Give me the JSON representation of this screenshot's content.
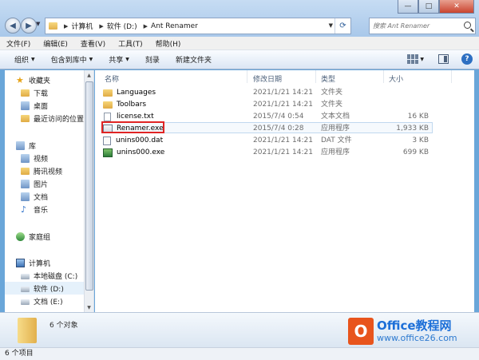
{
  "address": {
    "crumbs": [
      "计算机",
      "软件 (D:)",
      "Ant Renamer"
    ]
  },
  "search": {
    "placeholder": "搜索 Ant Renamer"
  },
  "window_controls": {
    "minimize": "—",
    "maximize": "□",
    "close": "✕"
  },
  "menu": [
    "文件(F)",
    "编辑(E)",
    "查看(V)",
    "工具(T)",
    "帮助(H)"
  ],
  "toolbar": {
    "organize": "组织",
    "include": "包含到库中",
    "share": "共享",
    "burn": "刻录",
    "new_folder": "新建文件夹",
    "help": "?"
  },
  "sidebar": {
    "favorites": "收藏夹",
    "downloads": "下载",
    "desktop": "桌面",
    "recent": "最近访问的位置",
    "libraries": "库",
    "videos": "视频",
    "tencent_video": "腾讯视频",
    "pictures": "图片",
    "documents": "文档",
    "music": "音乐",
    "homegroup": "家庭组",
    "computer": "计算机",
    "drive_c": "本地磁盘 (C:)",
    "drive_d": "软件 (D:)",
    "drive_e": "文档 (E:)"
  },
  "columns": {
    "name": "名称",
    "date": "修改日期",
    "type": "类型",
    "size": "大小"
  },
  "files": [
    {
      "name": "Languages",
      "date": "2021/1/21 14:21",
      "type": "文件夹",
      "size": "",
      "icon": "folder"
    },
    {
      "name": "Toolbars",
      "date": "2021/1/21 14:21",
      "type": "文件夹",
      "size": "",
      "icon": "folder"
    },
    {
      "name": "license.txt",
      "date": "2015/7/4 0:54",
      "type": "文本文档",
      "size": "16 KB",
      "icon": "text-file"
    },
    {
      "name": "Renamer.exe",
      "date": "2015/7/4 0:28",
      "type": "应用程序",
      "size": "1,933 KB",
      "icon": "application"
    },
    {
      "name": "unins000.dat",
      "date": "2021/1/21 14:21",
      "type": "DAT 文件",
      "size": "3 KB",
      "icon": "dat-file"
    },
    {
      "name": "unins000.exe",
      "date": "2021/1/21 14:21",
      "type": "应用程序",
      "size": "699 KB",
      "icon": "setup-app"
    }
  ],
  "details": {
    "count": "6 个对象"
  },
  "status": {
    "count": "6 个项目"
  },
  "watermark": {
    "logo_letter": "O",
    "title": "Office教程网",
    "url": "www.office26.com"
  },
  "colors": {
    "highlight": "#e02424",
    "accent": "#2d6fc2"
  }
}
